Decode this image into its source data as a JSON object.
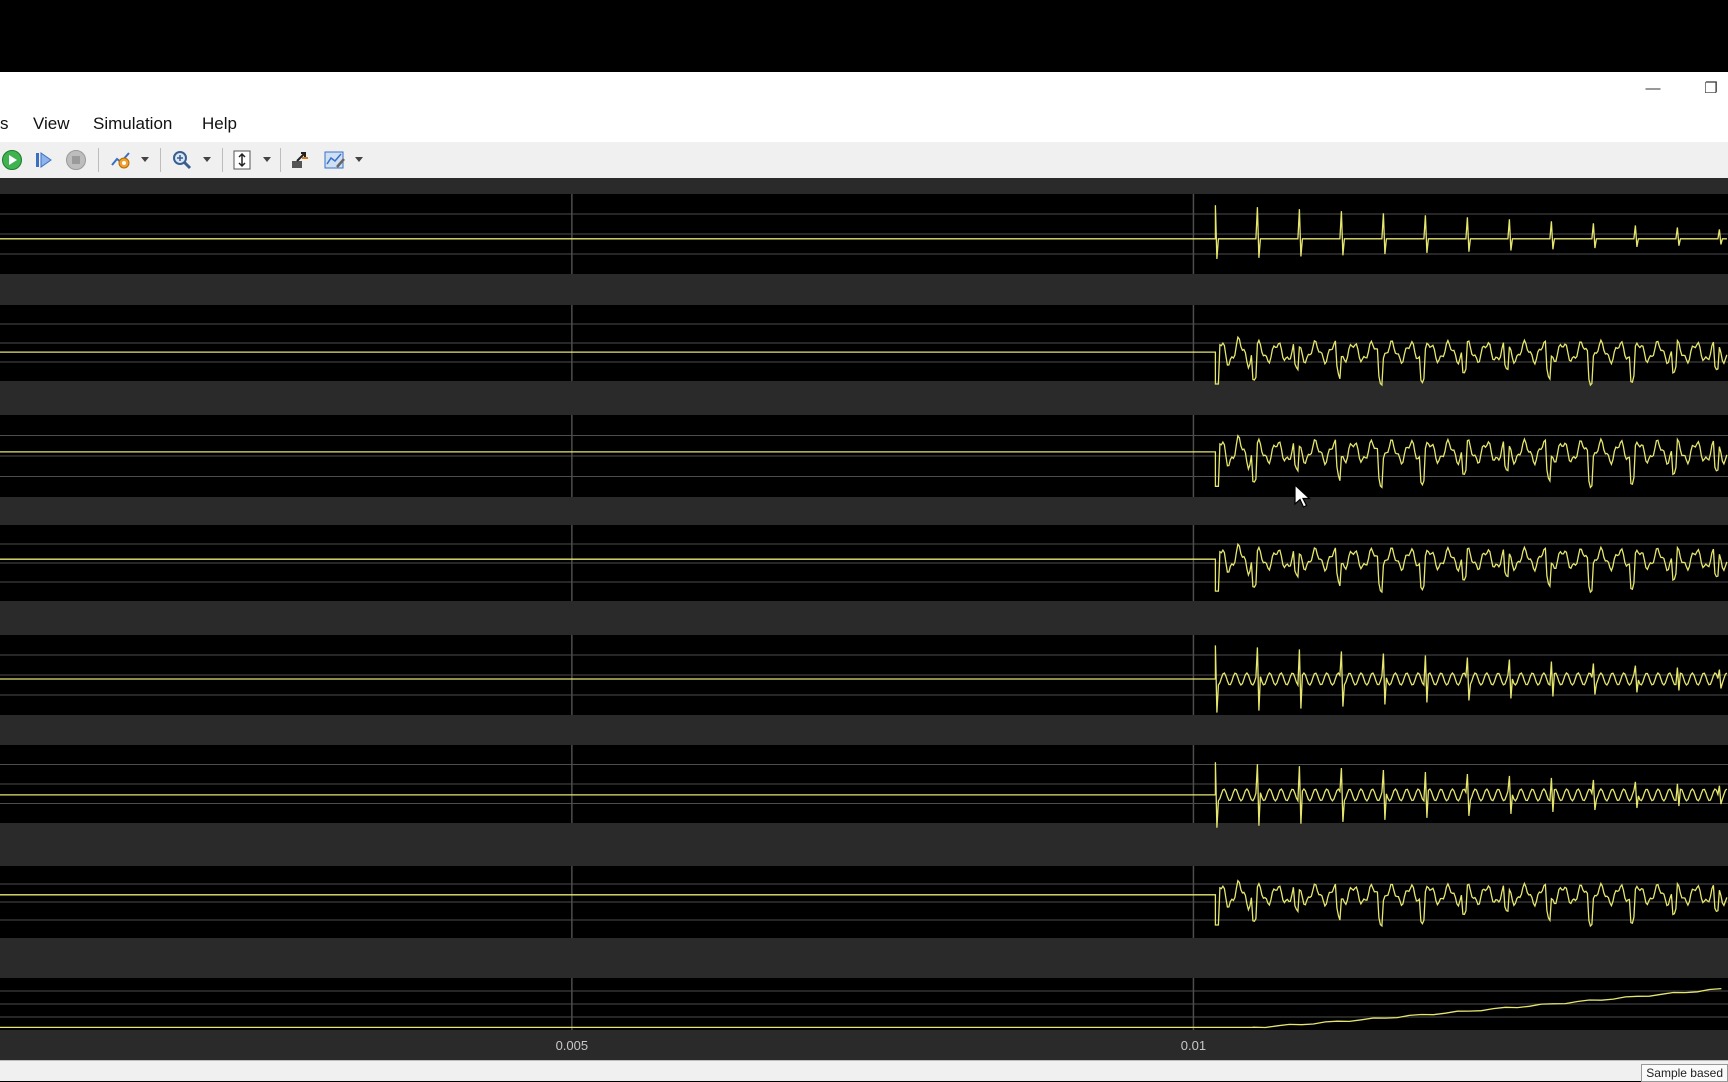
{
  "window": {
    "minimize_symbol": "—",
    "restore_symbol": "❐"
  },
  "menu": {
    "items": [
      "s",
      "View",
      "Simulation",
      "Help"
    ]
  },
  "toolbar": {
    "buttons": [
      "run-icon",
      "step-forward-icon",
      "stop-icon",
      "signal-settings-icon",
      "zoom-icon",
      "autoscale-icon",
      "highlight-simulink-block-icon",
      "scope-parameters-icon"
    ]
  },
  "scope": {
    "x_ticks": [
      "0.005",
      "0.01"
    ],
    "x_tick_values": [
      0.005,
      0.01
    ],
    "x_visible_range": [
      0.0004,
      0.0143
    ],
    "colors": {
      "background": "#2a2a2a",
      "plot": "#000000",
      "grid": "#4d4d4d",
      "signal": "#e6e66e",
      "axis_text": "#c8c8c8"
    },
    "panels": [
      {
        "signal": "impulse-train",
        "mid": 0.56,
        "disturbance_start": 0.01
      },
      {
        "signal": "oscillation",
        "mid": 0.62,
        "disturbance_start": 0.01
      },
      {
        "signal": "oscillation",
        "mid": 0.45,
        "disturbance_start": 0.01
      },
      {
        "signal": "oscillation",
        "mid": 0.45,
        "disturbance_start": 0.01
      },
      {
        "signal": "spike-oscillation",
        "mid": 0.55,
        "disturbance_start": 0.01
      },
      {
        "signal": "spike-oscillation",
        "mid": 0.64,
        "disturbance_start": 0.01
      },
      {
        "signal": "oscillation",
        "mid": 0.4,
        "disturbance_start": 0.01
      },
      {
        "signal": "ramp",
        "mid": 0.9,
        "disturbance_start": 0.01
      }
    ]
  },
  "status": {
    "text": "Sample based"
  }
}
